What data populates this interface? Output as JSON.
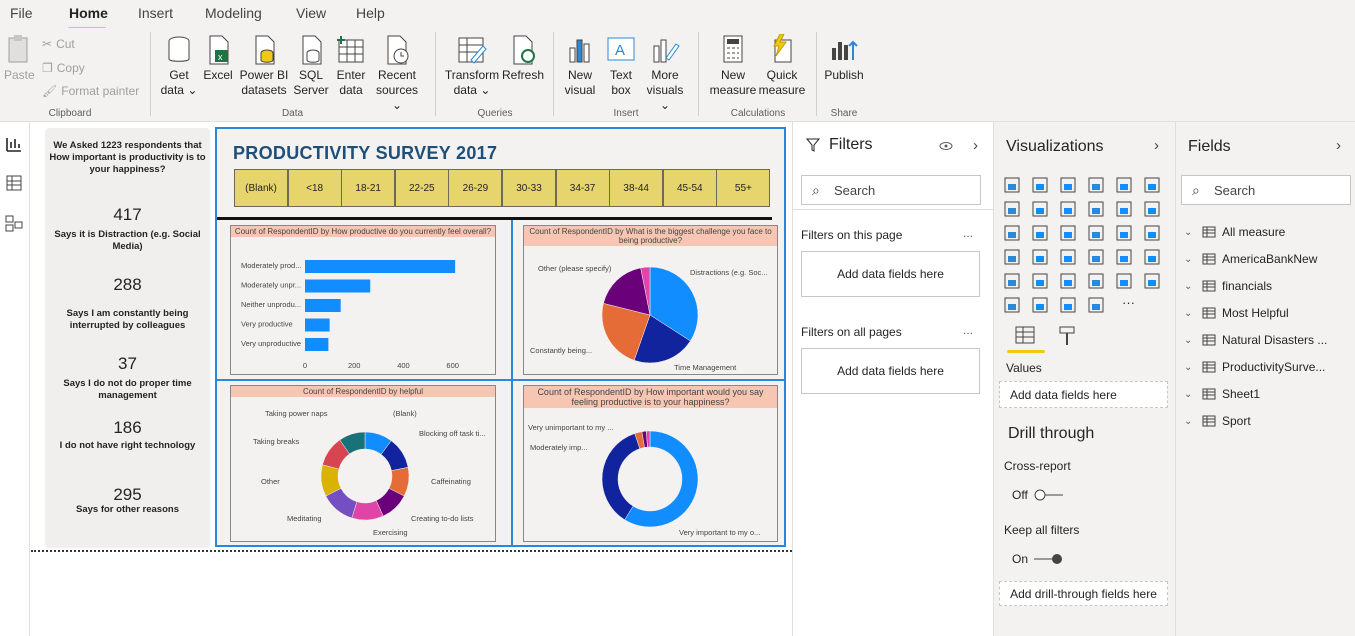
{
  "menu": {
    "file": "File",
    "home": "Home",
    "insert": "Insert",
    "modeling": "Modeling",
    "view": "View",
    "help": "Help"
  },
  "ribbon": {
    "paste": "Paste",
    "cut": "Cut",
    "copy": "Copy",
    "format_painter": "Format painter",
    "get_data": [
      "Get",
      "data ⌄"
    ],
    "excel": "Excel",
    "power_bi_datasets": [
      "Power BI",
      "datasets"
    ],
    "sql_server": [
      "SQL",
      "Server"
    ],
    "enter_data": [
      "Enter",
      "data"
    ],
    "recent_sources": [
      "Recent",
      "sources ⌄"
    ],
    "transform_data": [
      "Transform",
      "data ⌄"
    ],
    "refresh": "Refresh",
    "new_visual": [
      "New",
      "visual"
    ],
    "text_box": [
      "Text",
      "box"
    ],
    "more_visuals": [
      "More",
      "visuals ⌄"
    ],
    "new_measure": [
      "New",
      "measure"
    ],
    "quick_measure": [
      "Quick",
      "measure"
    ],
    "publish": "Publish",
    "groups": {
      "clipboard": "Clipboard",
      "data": "Data",
      "queries": "Queries",
      "insert": "Insert",
      "calculations": "Calculations",
      "share": "Share"
    }
  },
  "cards": {
    "intro": "We Asked 1223 respondents that  How important is productivity is to your happiness?",
    "items": [
      {
        "value": "417",
        "text": "Says it is Distraction (e.g. Social Media)"
      },
      {
        "value": "288",
        "text": "Says I am constantly being interrupted by colleagues"
      },
      {
        "value": "37",
        "text": "Says I do not do proper time management"
      },
      {
        "value": "186",
        "text": "I do not have right technology"
      },
      {
        "value": "295",
        "text": "Says for other reasons"
      }
    ]
  },
  "dashboard": {
    "title": "PRODUCTIVITY SURVEY 2017",
    "slicers": [
      "(Blank)",
      "<18",
      "18-21",
      "22-25",
      "26-29",
      "30-33",
      "34-37",
      "38-44",
      "45-54",
      "55+"
    ]
  },
  "chart_data": [
    {
      "type": "bar",
      "title": "Count of RespondentID by How productive do you currently feel overall?",
      "categories": [
        "Moderately prod...",
        "Moderately unpr...",
        "Neither unprodu...",
        "Very productive",
        "Very unproductive"
      ],
      "values": [
        610,
        265,
        145,
        100,
        95
      ],
      "xticks": [
        "0",
        "200",
        "400",
        "600"
      ],
      "xlim": [
        0,
        650
      ],
      "color": "#118dff"
    },
    {
      "type": "pie",
      "title": "Count of RespondentID by What is the biggest challenge you face to being productive?",
      "labels": [
        "Distractions (e.g. Soc...",
        "Time Management",
        "Constantly being...",
        "Other (please specify)"
      ],
      "values": [
        417,
        260,
        288,
        220
      ],
      "colors": [
        "#118dff",
        "#12239e",
        "#e66c37",
        "#6b007b"
      ],
      "extra": {
        "value": 38,
        "color": "#e044a7"
      }
    },
    {
      "type": "pie",
      "title": "Count of RespondentID by helpful",
      "donut": true,
      "labels": [
        "(Blank)",
        "Blocking off task ti...",
        "Caffeinating",
        "Creating to-do lists",
        "Exercising",
        "Meditating",
        "Other",
        "Taking breaks",
        "Taking power naps"
      ],
      "values": [
        105,
        120,
        110,
        110,
        120,
        130,
        120,
        115,
        100
      ],
      "colors": [
        "#118dff",
        "#12239e",
        "#e66c37",
        "#6b007b",
        "#e044a7",
        "#744ec2",
        "#d9b300",
        "#d64550",
        "#197278"
      ]
    },
    {
      "type": "pie",
      "title": "Count of RespondentID by How important would you say feeling productive is to your happiness?",
      "donut": true,
      "labels": [
        "Very important to my o...",
        "Moderately imp...",
        "Very unimportant to my ..."
      ],
      "values": [
        720,
        440,
        30
      ],
      "colors": [
        "#118dff",
        "#12239e",
        "#e66c37"
      ],
      "extra": [
        {
          "value": 18,
          "color": "#6b007b"
        },
        {
          "value": 15,
          "color": "#e044a7"
        }
      ]
    }
  ],
  "filters": {
    "title": "Filters",
    "search": "Search",
    "on_page": "Filters on this page",
    "on_all": "Filters on all pages",
    "add": "Add data fields here",
    "more": "..."
  },
  "viz": {
    "title": "Visualizations",
    "values": "Values",
    "add_values": "Add data fields here",
    "drill": "Drill through",
    "cross": "Cross-report",
    "off": "Off",
    "keep": "Keep all filters",
    "on": "On",
    "add_drill": "Add drill-through fields here",
    "more": "···"
  },
  "fields": {
    "title": "Fields",
    "search": "Search",
    "tables": [
      "All measure",
      "AmericaBankNew",
      "financials",
      "Most Helpful",
      "Natural Disasters ...",
      "ProductivitySurve...",
      "Sheet1",
      "Sport"
    ]
  }
}
